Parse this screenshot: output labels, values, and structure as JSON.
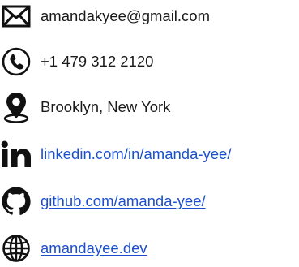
{
  "contacts": {
    "email": {
      "text": "amandakyee@gmail.com",
      "icon": "envelope-icon"
    },
    "phone": {
      "text": "+1 479 312 2120",
      "icon": "phone-icon"
    },
    "location": {
      "text": "Brooklyn, New York",
      "icon": "map-pin-icon"
    },
    "linkedin": {
      "text": "linkedin.com/in/amanda-yee/",
      "icon": "linkedin-icon"
    },
    "github": {
      "text": "github.com/amanda-yee/",
      "icon": "github-icon"
    },
    "website": {
      "text": "amandayee.dev",
      "icon": "globe-icon"
    }
  },
  "colors": {
    "text": "#1a1a1a",
    "link": "#1b4fcf",
    "icon": "#111111"
  }
}
